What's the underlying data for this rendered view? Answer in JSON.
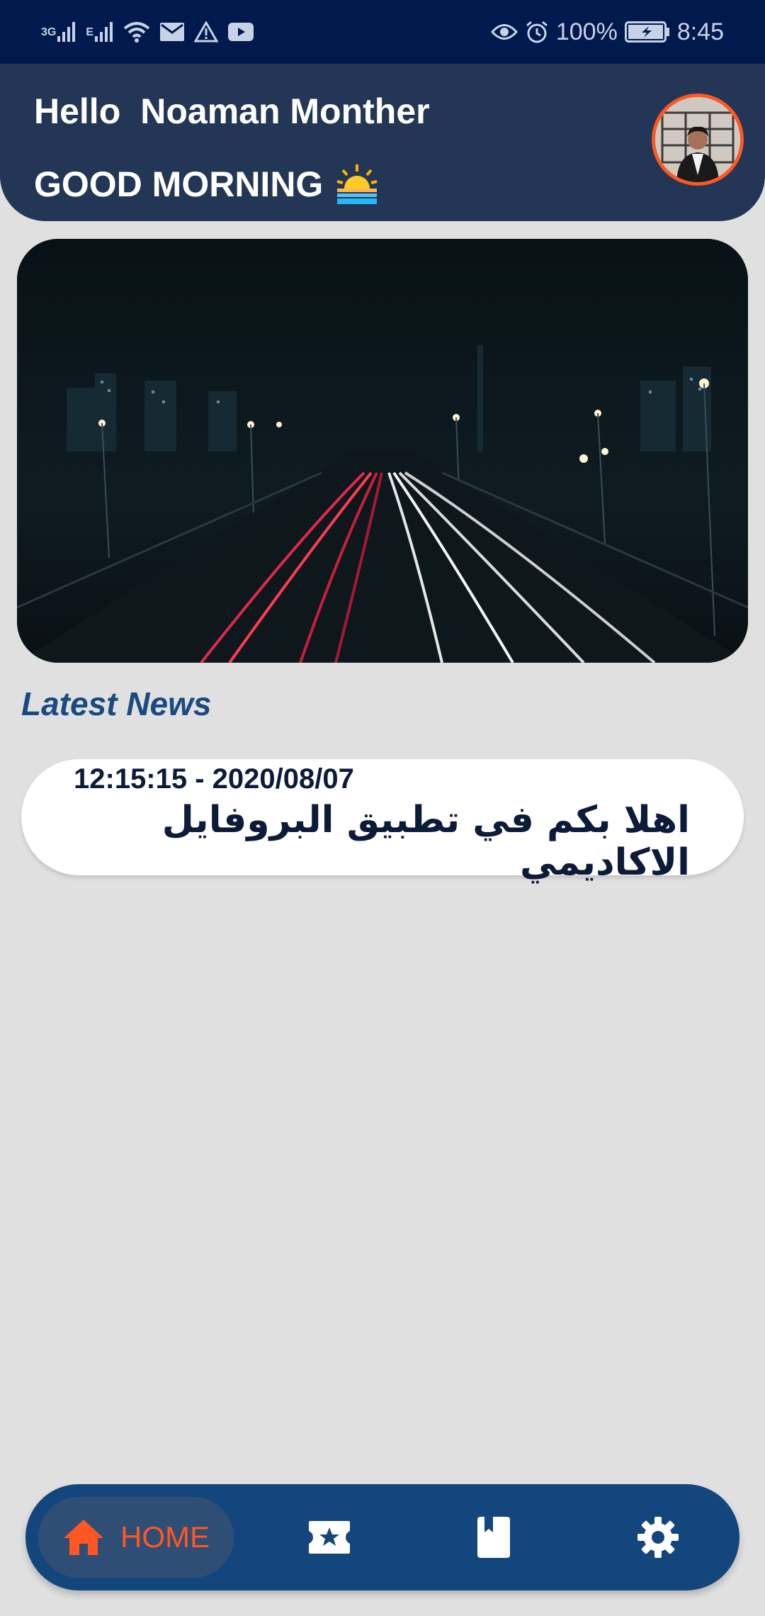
{
  "status_bar": {
    "net_label_1": "3G",
    "net_label_2": "E",
    "battery_percent": "100%",
    "time": "8:45",
    "icons": [
      "signal-3g-icon",
      "signal-e-icon",
      "wifi-icon",
      "mail-icon",
      "warning-icon",
      "youtube-icon",
      "eye-icon",
      "alarm-icon",
      "battery-charging-icon"
    ]
  },
  "header": {
    "hello": "Hello",
    "user_name": "Noaman Monther",
    "greeting": "GOOD MORNING",
    "greeting_icon": "sunrise-icon",
    "avatar_icon": "avatar"
  },
  "banner": {
    "image_icon": "night-highway-photo"
  },
  "news": {
    "section_title": "Latest News",
    "items": [
      {
        "datetime": "12:15:15 - 2020/08/07",
        "text": "اهلا بكم في تطبيق البروفايل الاكاديمي"
      }
    ]
  },
  "bottom_nav": {
    "home_label": "HOME",
    "items": [
      "home-icon",
      "ticket-star-icon",
      "book-icon",
      "settings-gear-icon"
    ]
  },
  "colors": {
    "status_bar": "#001a4d",
    "header": "#233656",
    "accent": "#ff5722",
    "nav": "#13467c",
    "title": "#1a4a80",
    "background": "#e0e0e0"
  }
}
